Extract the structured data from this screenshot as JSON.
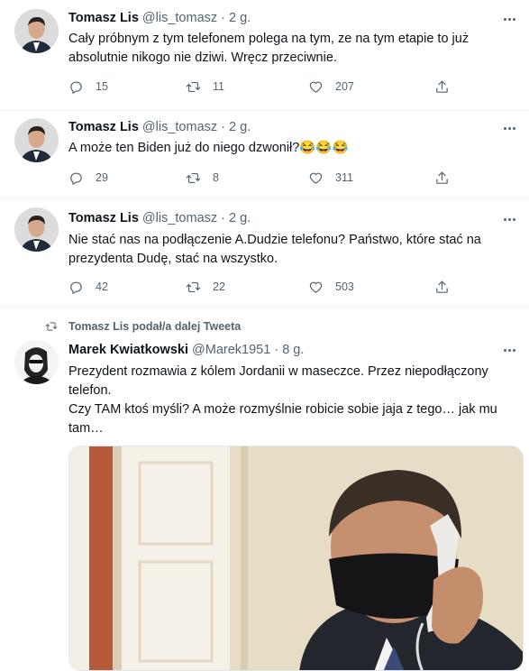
{
  "tweets": [
    {
      "name": "Tomasz Lis",
      "handle": "@lis_tomasz",
      "sep": "·",
      "time": "2 g.",
      "lines": [
        "Cały próbnym z tym telefonem polega na tym, ze na tym etapie to już",
        "absolutnie nikogo nie dziwi. Wręcz przeciwnie."
      ],
      "replies": "15",
      "retweets": "11",
      "likes": "207"
    },
    {
      "name": "Tomasz Lis",
      "handle": "@lis_tomasz",
      "sep": "·",
      "time": "2 g.",
      "lines": [
        "A może ten Biden już do niego  dzwonił?😂😂😂"
      ],
      "replies": "29",
      "retweets": "8",
      "likes": "311"
    },
    {
      "name": "Tomasz Lis",
      "handle": "@lis_tomasz",
      "sep": "·",
      "time": "2 g.",
      "lines": [
        "Nie stać nas na podłączenie A.Dudzie telefonu? Państwo, które stać na",
        "prezydenta Dudę, stać na wszystko."
      ],
      "replies": "42",
      "retweets": "22",
      "likes": "503"
    }
  ],
  "retweet": {
    "context": "Tomasz Lis podał/a dalej Tweeta",
    "name": "Marek Kwiatkowski",
    "handle": "@Marek1951",
    "sep": "·",
    "time": "8 g.",
    "lines": [
      "Prezydent rozmawia z kólem Jordanii w maseczce. Przez niepodłączony",
      "telefon.",
      "Czy TAM ktoś myśli? A może rozmyślnie robicie sobie jaja z tego… jak mu",
      "tam…"
    ]
  },
  "icons": {
    "reply": "reply-icon",
    "retweet": "retweet-icon",
    "like": "heart-icon",
    "share": "share-icon",
    "more": "more-icon"
  },
  "colors": {
    "text": "#0f1419",
    "secondary": "#536471",
    "divider": "#eff3f4"
  }
}
